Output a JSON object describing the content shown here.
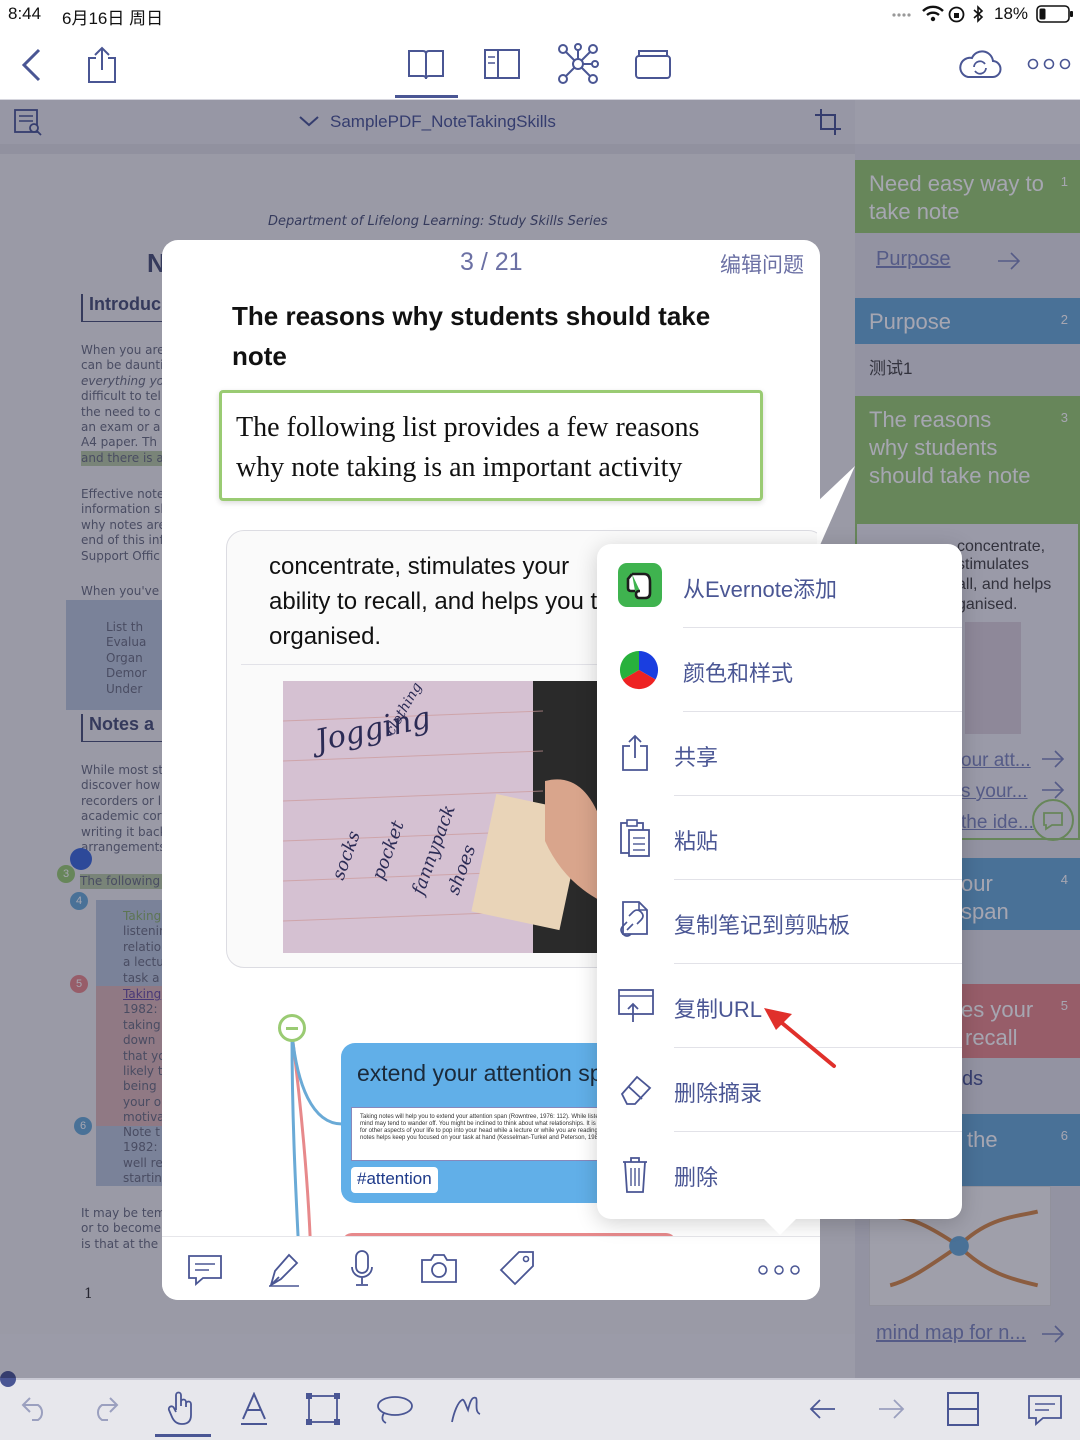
{
  "status": {
    "time": "8:44",
    "date": "6月16日 周日",
    "battery": "18%"
  },
  "pdf": {
    "doc_title": "SamplePDF_NoteTakingSkills",
    "series": "Department of Lifelong Learning: Study Skills Series",
    "title_letter": "N",
    "heading_intro": "Introduc",
    "heading_notes": "Notes a",
    "p1": [
      "When you are",
      "can be daunti",
      "everything yo",
      "difficult to tell",
      "the need to c",
      "an exam or a",
      "A4 paper.  Th",
      "and there is a"
    ],
    "p2": [
      "Effective note",
      "information sl",
      "why notes are",
      "end of this inf",
      "Support Offic"
    ],
    "p3": "When you've",
    "bullets1": [
      "List th",
      "Evalua",
      "Organ",
      "Demor",
      "Under"
    ],
    "p4": [
      "While most st",
      "discover how",
      "recorders or l",
      "academic cor",
      "writing it back",
      "arrangements"
    ],
    "following": "The following",
    "blue_bullet": [
      "Taking",
      "listenin",
      "relatio",
      "a lectu",
      "task a"
    ],
    "red_bullet": [
      "Taking",
      "1982:",
      "taking",
      "down",
      "that yo",
      "likely t",
      "being",
      "your o",
      "motiva"
    ],
    "blue_bullet2": [
      "Note t",
      "1982: ",
      "well re",
      "startin"
    ],
    "p5": [
      "It may be tem",
      "or to become",
      "is that at the"
    ],
    "page_num": "1",
    "markers": [
      "3",
      "4",
      "5",
      "6"
    ]
  },
  "cards": [
    {
      "num": "1",
      "title": "Need easy way to take note",
      "color": "#9acb73",
      "link": "Purpose"
    },
    {
      "num": "2",
      "title": "Purpose",
      "color": "#6aaad6",
      "sub": "测试1"
    },
    {
      "num": "3",
      "title": "The reasons why students should take note",
      "color": "#9acb73",
      "body1": "concentrate, stimulates",
      "body2": "all, and helps",
      "body3": "ganised.",
      "links": [
        "our att...",
        "s your...",
        "the ide..."
      ]
    },
    {
      "num": "4",
      "title": "our",
      "title2": "span",
      "color": "#6aaad6"
    },
    {
      "num": "5",
      "title": "es your",
      "title2": "recall",
      "color": "#e7898b",
      "extra": "ds"
    },
    {
      "num": "6",
      "title": "the",
      "color": "#6aaad6",
      "link": "mind map for n..."
    }
  ],
  "popup": {
    "counter": "3 / 21",
    "edit": "编辑问题",
    "question": "The reasons why students should take note",
    "answer": "The following list provides a few reasons why note taking is an important activity",
    "excerpt": [
      "concentrate, stimulates your",
      "ability to recall, and helps you t",
      "organised."
    ],
    "node_title": "extend your attention sp",
    "node_small": "Taking notes will help you to extend your attention span (Rowntree, 1976: 112). While listening, your mind may tend to wander off. You might be inclined to think about what relationships. It is quite easy for other aspects of your life to pop into your head while a lecture or while you are reading. Taking notes helps keep you focused on your task at hand (Kesselman-Turkel and Peterson, 1982: 2).",
    "tag": "#attention",
    "photo_words": [
      "Jogging",
      "clothing",
      "socks",
      "pocket",
      "fannypack",
      "shoes"
    ]
  },
  "menu": [
    "从Evernote添加",
    "颜色和样式",
    "共享",
    "粘贴",
    "复制笔记到剪贴板",
    "复制URL",
    "删除摘录",
    "删除"
  ],
  "colors": {
    "accent": "#4a5694",
    "green": "#9acb73",
    "blue": "#6aaad6",
    "red": "#e7898b",
    "arrow": "#e0302b"
  }
}
